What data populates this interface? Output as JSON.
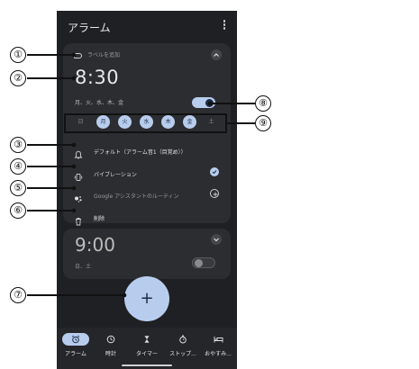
{
  "app": {
    "title": "アラーム"
  },
  "alarm1": {
    "label_placeholder": "ラベルを追加",
    "time": "8:30",
    "repeat_summary": "月、火、水、木、金",
    "enabled": true,
    "days": [
      {
        "label": "日",
        "on": false
      },
      {
        "label": "月",
        "on": true
      },
      {
        "label": "火",
        "on": true
      },
      {
        "label": "水",
        "on": true
      },
      {
        "label": "木",
        "on": true
      },
      {
        "label": "金",
        "on": true
      },
      {
        "label": "土",
        "on": false
      }
    ],
    "sound": "デフォルト（アラーム音1（目覚め））",
    "vibration": "バイブレーション",
    "vibration_checked": true,
    "assistant": "Google アシスタントのルーティン",
    "delete": "削除"
  },
  "alarm2": {
    "time": "9:00",
    "repeat_summary": "日、土",
    "enabled": false
  },
  "fab": {
    "symbol": "+"
  },
  "nav": {
    "items": [
      {
        "label": "アラーム",
        "icon": "alarm-icon",
        "active": true
      },
      {
        "label": "時計",
        "icon": "clock-icon",
        "active": false
      },
      {
        "label": "タイマー",
        "icon": "hourglass-icon",
        "active": false
      },
      {
        "label": "ストップ...",
        "icon": "stopwatch-icon",
        "active": false
      },
      {
        "label": "おやすみ...",
        "icon": "bed-icon",
        "active": false
      }
    ]
  },
  "callouts": [
    "①",
    "②",
    "③",
    "④",
    "⑤",
    "⑥",
    "⑦",
    "⑧",
    "⑨"
  ],
  "colors": {
    "accent": "#b8cdee",
    "background": "#1f2023",
    "card": "#2c2d30"
  }
}
